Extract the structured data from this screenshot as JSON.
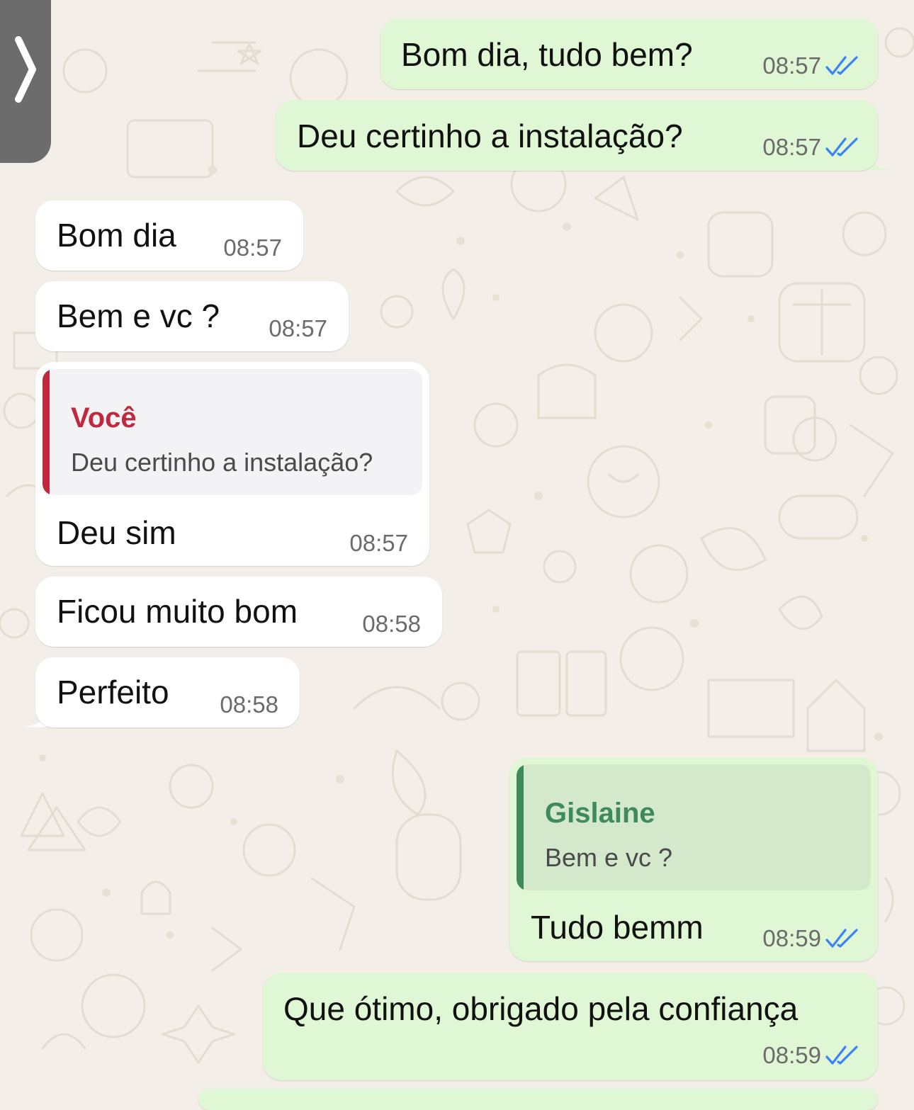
{
  "theme": {
    "outgoing_bubble": "#dff7d4",
    "incoming_bubble": "#ffffff",
    "read_ticks": "#3b82f6",
    "reply_you_color": "#c0283e",
    "reply_contact_color": "#3f8a5c",
    "wallpaper": "#f3efe8",
    "back_tab": "#6c6c6c"
  },
  "navigation": {
    "back_icon": "chevron-right-icon"
  },
  "messages": [
    {
      "direction": "outgoing",
      "text": "Bom dia, tudo bem?",
      "time": "08:57",
      "status": "read"
    },
    {
      "direction": "outgoing",
      "text": "Deu certinho a instalação?",
      "time": "08:57",
      "status": "read"
    },
    {
      "direction": "incoming",
      "text": "Bom dia",
      "time": "08:57"
    },
    {
      "direction": "incoming",
      "text": "Bem e vc ?",
      "time": "08:57"
    },
    {
      "direction": "incoming",
      "text": "Deu sim",
      "time": "08:57",
      "reply_to": {
        "author": "Você",
        "text": "Deu certinho a instalação?"
      }
    },
    {
      "direction": "incoming",
      "text": "Ficou muito bom",
      "time": "08:58"
    },
    {
      "direction": "incoming",
      "text": "Perfeito",
      "time": "08:58"
    },
    {
      "direction": "outgoing",
      "text": "Tudo bemm",
      "time": "08:59",
      "status": "read",
      "reply_to": {
        "author": "Gislaine",
        "text": "Bem e vc ?"
      }
    },
    {
      "direction": "outgoing",
      "text": "Que ótimo, obrigado pela confiança",
      "time": "08:59",
      "status": "read"
    }
  ]
}
